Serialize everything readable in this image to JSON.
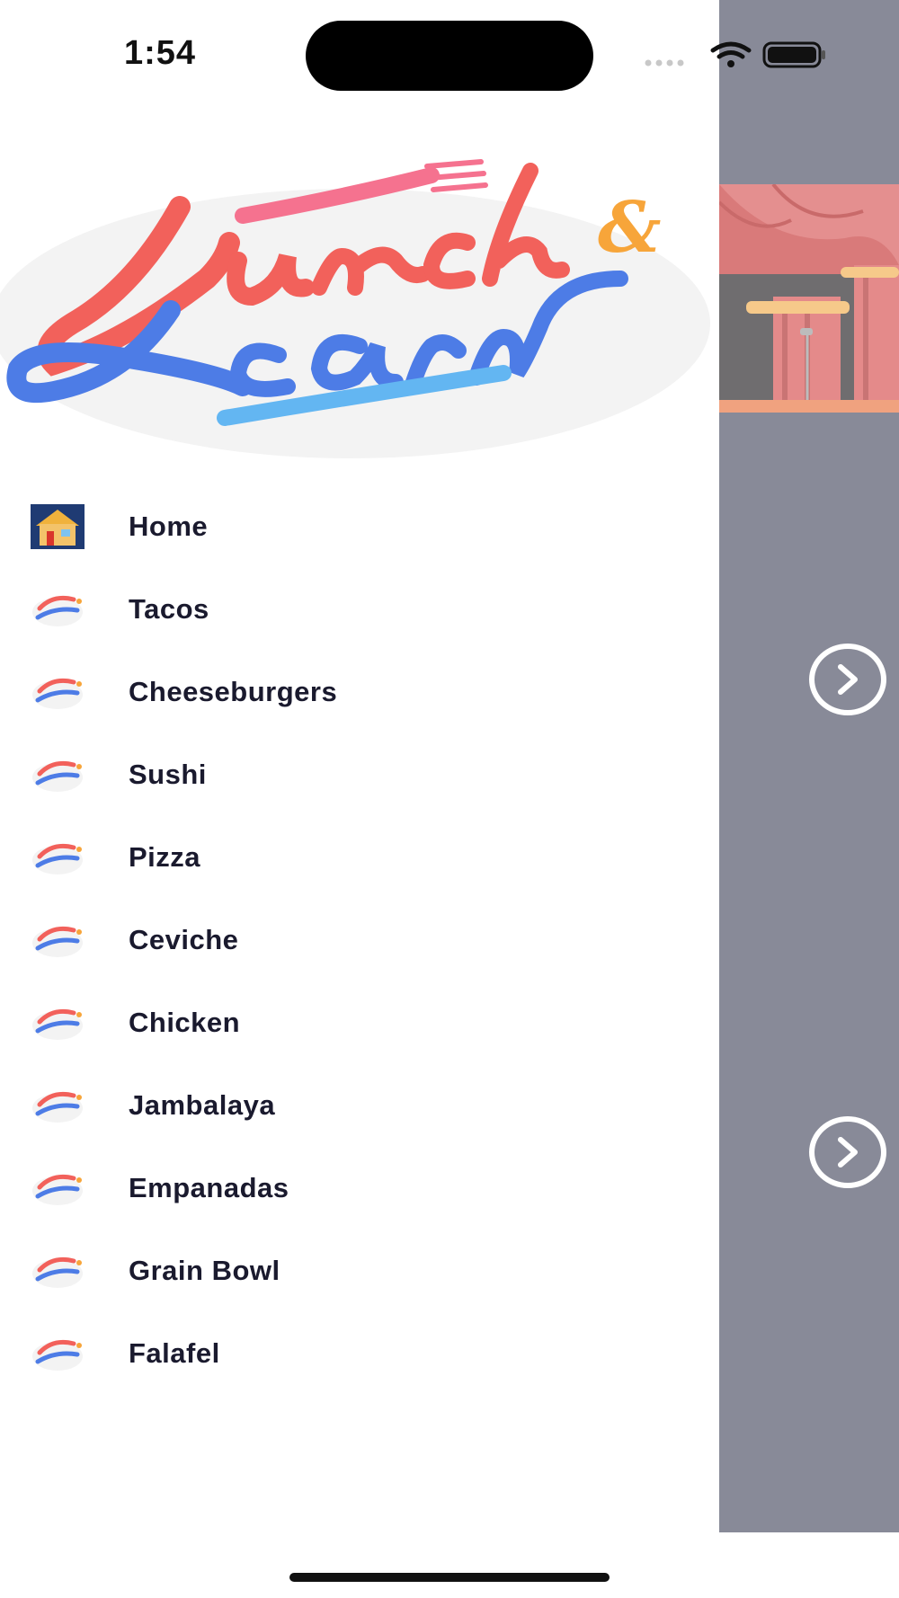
{
  "status_bar": {
    "time": "1:54",
    "icons": [
      "cellular-icon",
      "wifi-icon",
      "battery-icon"
    ]
  },
  "logo": {
    "text": "Lunch & Learn",
    "colors": {
      "lunch": "#f2615b",
      "learn": "#4d7ce6",
      "ampersand": "#f7a53a",
      "fork": "#f5728f",
      "knife": "#63b6f2"
    }
  },
  "menu": {
    "items": [
      {
        "label": "Home",
        "icon": "home-icon"
      },
      {
        "label": "Tacos",
        "icon": "lunch-and-learn-logo-icon"
      },
      {
        "label": "Cheeseburgers",
        "icon": "lunch-and-learn-logo-icon"
      },
      {
        "label": "Sushi",
        "icon": "lunch-and-learn-logo-icon"
      },
      {
        "label": "Pizza",
        "icon": "lunch-and-learn-logo-icon"
      },
      {
        "label": "Ceviche",
        "icon": "lunch-and-learn-logo-icon"
      },
      {
        "label": "Chicken",
        "icon": "lunch-and-learn-logo-icon"
      },
      {
        "label": "Jambalaya",
        "icon": "lunch-and-learn-logo-icon"
      },
      {
        "label": "Empanadas",
        "icon": "lunch-and-learn-logo-icon"
      },
      {
        "label": "Grain Bowl",
        "icon": "lunch-and-learn-logo-icon"
      },
      {
        "label": "Falafel",
        "icon": "lunch-and-learn-logo-icon"
      }
    ]
  },
  "background_content": {
    "overlay_color": "#888a98",
    "buttons": [
      "chevron-right-icon",
      "chevron-right-icon"
    ]
  }
}
